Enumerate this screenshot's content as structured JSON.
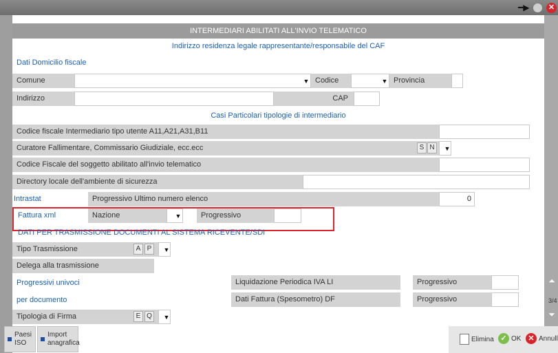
{
  "window": {
    "pin_icon": "pin-icon",
    "minimize_icon": "circle-icon",
    "close_icon": "close-icon",
    "close_color": "#d9232b"
  },
  "header": {
    "title": "INTERMEDIARI ABILITATI ALL'INVIO TELEMATICO",
    "subtitle": "Indirizzo residenza legale rappresentante/responsabile del CAF"
  },
  "domicilio": {
    "section_title": "Dati Domicilio fiscale",
    "comune_label": "Comune",
    "comune_value": "",
    "codice_label": "Codice",
    "codice_value": "",
    "provincia_label": "Provincia",
    "provincia_value": "",
    "indirizzo_label": "Indirizzo",
    "indirizzo_value": "",
    "cap_label": "CAP",
    "cap_value": ""
  },
  "casi": {
    "section_title": "Casi Particolari tipologie di intermediario",
    "cf_intermediario_label": "Codice fiscale Intermediario tipo utente A11,A21,A31,B11",
    "cf_intermediario_value": "",
    "curatore_label": "Curatore Fallimentare, Commissario Giudiziale, ecc.ecc",
    "curatore_opt_s": "S",
    "curatore_opt_n": "N",
    "cf_soggetto_label": "Codice Fiscale del soggetto abilitato all'invio telematico",
    "cf_soggetto_value": "",
    "directory_label": "Directory locale dell'ambiente di sicurezza",
    "directory_value": ""
  },
  "intrastat": {
    "label": "Intrastat",
    "progressivo_label": "Progressivo Ultimo numero elenco",
    "progressivo_value": "0"
  },
  "fattura": {
    "label": "Fattura xml",
    "nazione_label": "Nazione",
    "nazione_value": "",
    "progressivo_label": "Progressivo",
    "progressivo_value": ""
  },
  "trasmissione": {
    "section_title": "DATI PER TRASMISSIONE DOCUMENTI AL SISTEMA RICEVENTE/SDI",
    "tipo_label": "Tipo Trasmissione",
    "tipo_opt_a": "A",
    "tipo_opt_p": "P",
    "delega_label": "Delega alla trasmissione"
  },
  "progressivi": {
    "label_1": "Progressivi univoci",
    "label_2": "per documento",
    "lipe_label": "Liquidazione Periodica IVA LI",
    "lipe_prog_label": "Progressivo",
    "lipe_prog_value": "",
    "df_label": "Dati Fattura (Spesometro) DF",
    "df_prog_label": "Progressivo",
    "df_prog_value": ""
  },
  "firma": {
    "label": "Tipologia di Firma",
    "opt_e": "E",
    "opt_q": "Q"
  },
  "scroll": {
    "page_indicator": "3/4"
  },
  "bottom": {
    "paesi_line1": "Paesi",
    "paesi_line2": "ISO",
    "import_line1": "Import",
    "import_line2": "anagrafica",
    "elimina_label": "Elimina",
    "ok_label": "OK",
    "annulla_label": "Annull"
  },
  "colors": {
    "accent_blue": "#1a5fb4",
    "highlight_red": "#e0242c",
    "ok_green": "#7cc04b",
    "label_grey": "#d3d3d3",
    "title_grey": "#9b9b9b"
  }
}
